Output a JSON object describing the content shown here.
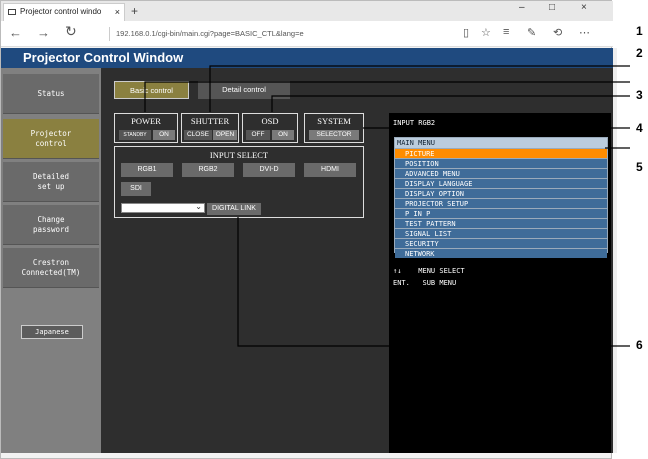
{
  "browser": {
    "tab_title": "Projector control windo",
    "tab_close": "×",
    "new_tab": "+",
    "url": "192.168.0.1/cgi-bin/main.cgi?page=BASIC_CTL&lang=e",
    "window_controls": [
      "–",
      "□",
      "×"
    ]
  },
  "page": {
    "title": "Projector Control Window"
  },
  "sidebar": {
    "items": [
      {
        "label": "Status"
      },
      {
        "label": "Projector\ncontrol"
      },
      {
        "label": "Detailed\nset up"
      },
      {
        "label": "Change\npassword"
      },
      {
        "label": "Crestron\nConnected(TM)"
      }
    ],
    "language": "Japanese"
  },
  "modes": {
    "basic": "Basic control",
    "detail": "Detail control"
  },
  "groups": {
    "power": {
      "title": "POWER",
      "standby": "STANDBY",
      "on": "ON"
    },
    "shutter": {
      "title": "SHUTTER",
      "close": "CLOSE",
      "open": "OPEN"
    },
    "osd": {
      "title": "OSD",
      "off": "OFF",
      "on": "ON"
    },
    "system": {
      "title": "SYSTEM",
      "selector": "SELECTOR"
    }
  },
  "input_select": {
    "title": "INPUT SELECT",
    "buttons": [
      "RGB1",
      "RGB2",
      "DVI-D",
      "HDMI",
      "SDI"
    ],
    "digital_link": "DIGITAL LINK"
  },
  "osd_screen": {
    "input": "INPUT RGB2",
    "menu_title": "MAIN MENU",
    "menu_items": [
      "PICTURE",
      "POSITION",
      "ADVANCED MENU",
      "DISPLAY LANGUAGE",
      "DISPLAY OPTION",
      "PROJECTOR SETUP",
      "P IN P",
      "TEST PATTERN",
      "SIGNAL LIST",
      "SECURITY",
      "NETWORK"
    ],
    "help1": "↑↓    MENU SELECT",
    "help2": "ENT.   SUB MENU"
  },
  "callouts": [
    "1",
    "2",
    "3",
    "4",
    "5",
    "6"
  ],
  "colors": {
    "title_bar": "#1f4a7f",
    "menu_item": "#3f6c99",
    "menu_selected": "#ff8c00",
    "active_side": "#8a8040"
  }
}
